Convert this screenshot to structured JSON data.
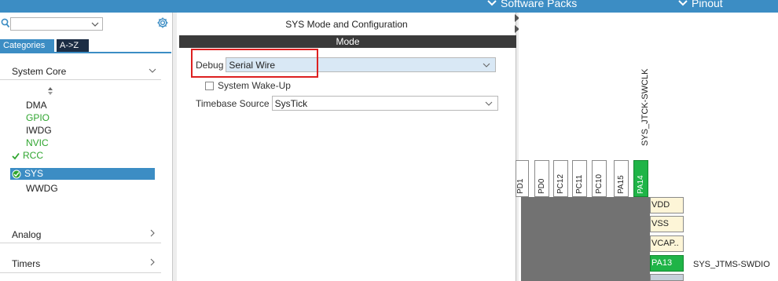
{
  "topbar": {
    "software_packs": "Software Packs",
    "pinout": "Pinout"
  },
  "sidebar": {
    "search_value": "",
    "tabs": {
      "categories": "Categories",
      "az": "A->Z"
    },
    "categories": {
      "system_core": "System Core",
      "analog": "Analog",
      "timers": "Timers"
    },
    "items": [
      {
        "label": "DMA",
        "color": "#222222"
      },
      {
        "label": "GPIO",
        "color": "#2fa52f"
      },
      {
        "label": "IWDG",
        "color": "#222222"
      },
      {
        "label": "NVIC",
        "color": "#2fa52f"
      },
      {
        "label": "RCC",
        "color": "#2fa52f"
      },
      {
        "label": "SYS",
        "color": "#ffffff"
      },
      {
        "label": "WWDG",
        "color": "#222222"
      }
    ]
  },
  "config": {
    "title": "SYS Mode and Configuration",
    "mode_header": "Mode",
    "debug_label": "Debug",
    "debug_value": "Serial Wire",
    "wakeup_label": "System Wake-Up",
    "timebase_label": "Timebase Source",
    "timebase_value": "SysTick"
  },
  "pinout": {
    "top_vertical_label": "SYS_JTCK-SWCLK",
    "top_pins": [
      "PD1",
      "PD0",
      "PC12",
      "PC11",
      "PC10",
      "PA15",
      "PA14"
    ],
    "side_pins": [
      "VDD",
      "VSS",
      "VCAP..",
      "PA13"
    ],
    "side_label": "SYS_JTMS-SWDIO"
  },
  "colors": {
    "accent": "#3c8dc4",
    "pin_green": "#1fb447",
    "pin_power": "#fdf5d7",
    "highlight_red": "#dd2020",
    "chip_gray": "#727272"
  }
}
